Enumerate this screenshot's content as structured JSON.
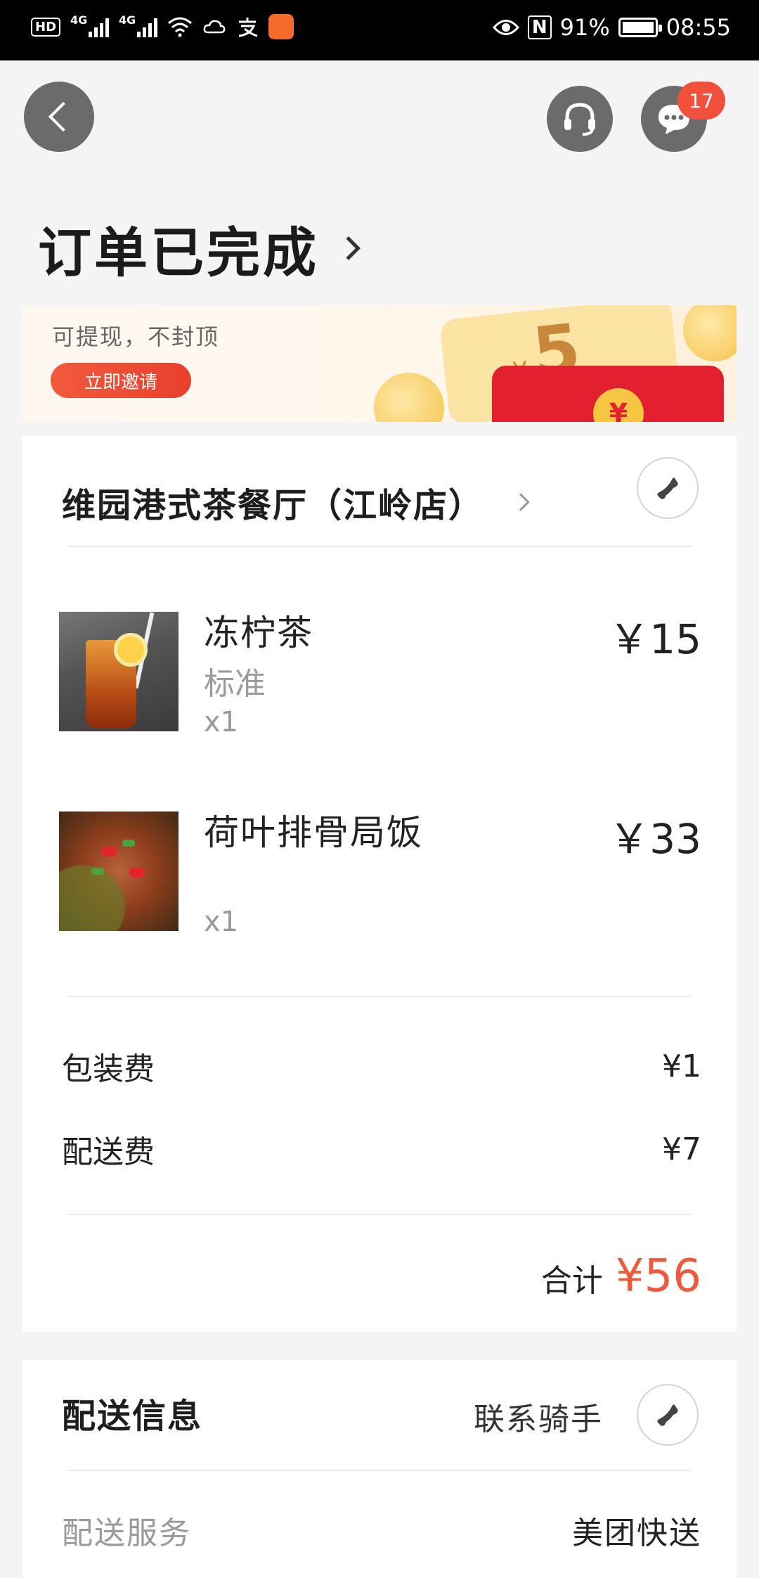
{
  "status_bar": {
    "hd": "HD",
    "net1": "4G",
    "net2": "4G",
    "nfc": "N",
    "battery": "91%",
    "time": "08:55",
    "icons": [
      "wifi-icon",
      "weather-icon",
      "alipay-icon",
      "app-icon",
      "eye-icon",
      "nfc-icon",
      "battery-icon"
    ]
  },
  "header": {
    "back_icon": "chevron-left-icon",
    "service_icon": "headset-icon",
    "message_icon": "message-icon",
    "message_badge": "17"
  },
  "page": {
    "title": "订单已完成"
  },
  "banner": {
    "text": "可提现，不封顶",
    "button": "立即邀请",
    "ticket_value": "5",
    "ticket_currency": "¥",
    "coin_symbol": "¥"
  },
  "order": {
    "shop_name": "维园港式茶餐厅（江岭店）",
    "items": [
      {
        "name": "冻柠茶",
        "spec": "标准",
        "qty": "x1",
        "price": "￥15"
      },
      {
        "name": "荷叶排骨局饭",
        "spec": "",
        "qty": "x1",
        "price": "￥33"
      }
    ],
    "fees": [
      {
        "label": "包装费",
        "value": "¥1"
      },
      {
        "label": "配送费",
        "value": "¥7"
      }
    ],
    "total_label": "合计",
    "total_value": "¥56"
  },
  "delivery": {
    "title": "配送信息",
    "contact_rider": "联系骑手",
    "service_label": "配送服务",
    "service_value": "美团快送"
  },
  "colors": {
    "accent": "#f05a3c",
    "badge": "#f0503c",
    "background": "#f4f4f4"
  }
}
